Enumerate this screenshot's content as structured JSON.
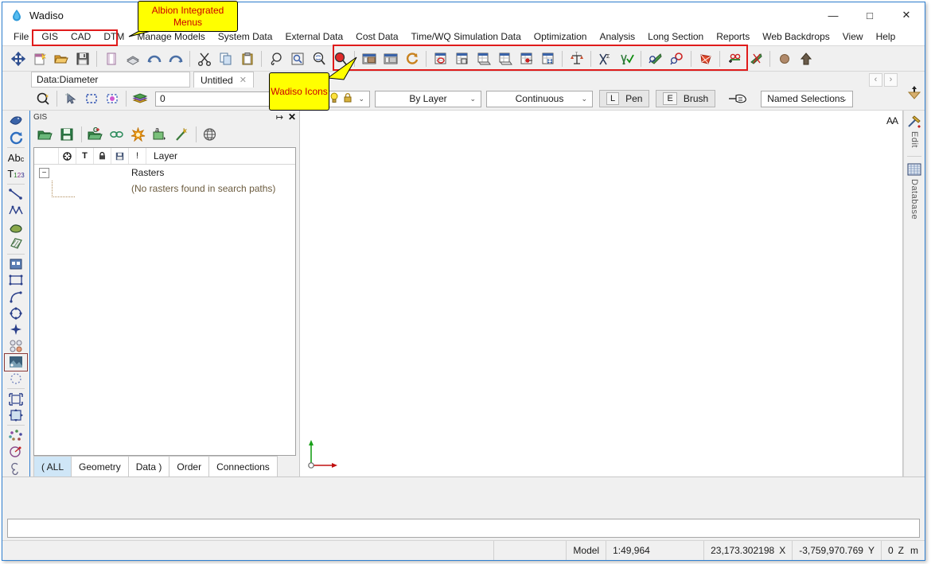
{
  "window": {
    "title": "Wadiso",
    "app_icon": "water-drop-icon",
    "controls": {
      "minimize": "—",
      "maximize": "□",
      "close": "✕"
    }
  },
  "menubar": {
    "items": [
      {
        "label": "File",
        "name": "menu-file"
      },
      {
        "label": "GIS",
        "name": "menu-gis",
        "highlighted": true
      },
      {
        "label": "CAD",
        "name": "menu-cad",
        "highlighted": true
      },
      {
        "label": "DTM",
        "name": "menu-dtm",
        "highlighted": true
      },
      {
        "label": "Manage Models",
        "name": "menu-manage-models"
      },
      {
        "label": "System Data",
        "name": "menu-system-data"
      },
      {
        "label": "External Data",
        "name": "menu-external-data"
      },
      {
        "label": "Cost Data",
        "name": "menu-cost-data"
      },
      {
        "label": "Time/WQ Simulation Data",
        "name": "menu-time-wq-simulation-data"
      },
      {
        "label": "Optimization",
        "name": "menu-optimization"
      },
      {
        "label": "Analysis",
        "name": "menu-analysis"
      },
      {
        "label": "Long Section",
        "name": "menu-long-section"
      },
      {
        "label": "Reports",
        "name": "menu-reports"
      },
      {
        "label": "Web Backdrops",
        "name": "menu-web-backdrops"
      },
      {
        "label": "View",
        "name": "menu-view"
      },
      {
        "label": "Help",
        "name": "menu-help"
      }
    ]
  },
  "toolbar_main": {
    "icons": [
      "pan-move-icon",
      "new-file-icon",
      "open-folder-icon",
      "save-icon",
      "page-setup-icon",
      "print-icon",
      "undo-icon",
      "redo-icon",
      "cut-scissors-icon",
      "copy-icon",
      "paste-icon",
      "zoom-lasso-icon",
      "zoom-window-icon",
      "zoom-extents-icon",
      "zoom-previous-icon",
      "model-window-icon",
      "model-window-alt-icon",
      "refresh-icon",
      "table-query-icon",
      "table-block-icon",
      "table-edit-icon",
      "table-edit-alt-icon",
      "table-flag-icon",
      "table-filter-icon",
      "annotation-scale-icon",
      "pipe-sigma-icon",
      "pipe-check-icon",
      "pipe-zoom-icon",
      "node-zoom-icon",
      "mesh-icon",
      "add-nodes-icon",
      "cut-pipe-icon",
      "sphere-icon",
      "extrude-up-icon"
    ]
  },
  "data_row": {
    "data_label": "Data:Diameter",
    "document_tab": "Untitled",
    "close_glyph": "✕",
    "nav_prev": "‹",
    "nav_next": "›"
  },
  "toolbar_props": {
    "select_icons": [
      "object-snap-icon",
      "pick-arrow-icon",
      "window-select-icon",
      "crossing-select-icon",
      "layers-icon"
    ],
    "value_input": "0",
    "color_combo": {
      "value": "",
      "icons": [
        "color-swatch-icon",
        "lightbulb-icon",
        "lock-icon"
      ],
      "chevron": "⌄"
    },
    "linewidth_combo": "By Layer",
    "linetype_combo": "Continuous",
    "pen_button": {
      "key": "L",
      "label": "Pen"
    },
    "brush_button": {
      "key": "E",
      "label": "Brush"
    },
    "pointer_icon": "hand-pointer-icon",
    "named_selections_combo": "Named Selections",
    "expand_icon": "expand-arrow-icon"
  },
  "left_toolbar": {
    "icons": [
      "bird-marker-icon",
      "rotate-icon",
      "text-abc-icon",
      "text-number-icon",
      "line-icon",
      "polyline-icon",
      "polygon-fill-icon",
      "hatch-icon",
      "block-icon",
      "rectangle-icon",
      "arc-icon",
      "circle-node-icon",
      "snap-point-icon",
      "multi-circle-icon",
      "image-icon",
      "lasso-dotted-icon",
      "scale-icon",
      "move-icon",
      "scatter-icon",
      "rotate-copy-icon",
      "spiral-icon"
    ]
  },
  "gis_panel": {
    "title": "GIS",
    "pin_glyph": "↦",
    "close_glyph": "✕",
    "toolbar_icons": [
      "open-gis-icon",
      "save-gis-icon",
      "open-georef-icon",
      "link-icon",
      "render-sun-icon",
      "label-icon",
      "magic-wand-icon",
      "globe-icon"
    ],
    "tree_columns": [
      {
        "name": "col-visible",
        "glyph": "✦"
      },
      {
        "name": "col-text",
        "glyph": "T"
      },
      {
        "name": "col-lock",
        "glyph": "◦"
      },
      {
        "name": "col-save",
        "glyph": "■"
      },
      {
        "name": "col-alert",
        "glyph": "!"
      }
    ],
    "layer_header": "Layer",
    "rows": [
      {
        "label": "Rasters",
        "type": "group",
        "expander": "−"
      },
      {
        "label": "(No rasters found in search paths)",
        "type": "message"
      }
    ],
    "tabs": [
      {
        "label": "( ALL",
        "active": true
      },
      {
        "label": "Geometry",
        "active": false
      },
      {
        "label": "Data )",
        "active": false
      },
      {
        "label": "Order",
        "active": false
      },
      {
        "label": "Connections",
        "active": false
      }
    ]
  },
  "canvas": {
    "aa_label": "AA",
    "axis_x_label": "",
    "axis_y_label": ""
  },
  "right_dock": {
    "items": [
      {
        "label": "Edit",
        "icon": "tools-hammer-icon"
      },
      {
        "label": "Database",
        "icon": "grid-table-icon"
      }
    ]
  },
  "statusbar": {
    "model_label": "Model",
    "scale": "1:49,964",
    "x_value": "23,173.302198",
    "x_unit": "X",
    "y_value": "-3,759,970.769",
    "y_unit": "Y",
    "z_value": "0",
    "z_unit": "Z",
    "units": "m"
  },
  "callouts": [
    {
      "text": "Albion Integrated Menus",
      "name": "callout-albion-menus"
    },
    {
      "text": "Wadiso Icons",
      "name": "callout-wadiso-icons"
    }
  ],
  "colors": {
    "accent_border": "#2f7fd0",
    "highlight_red": "#e01b1b",
    "callout_bg": "#ffff00",
    "callout_text": "#cc0000",
    "tab_active": "#cfe6f7"
  }
}
